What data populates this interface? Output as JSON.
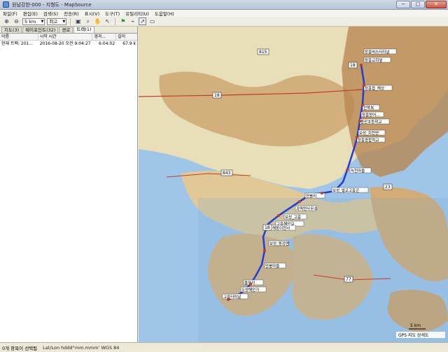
{
  "window": {
    "title": "원남강한-000 - 지형도 - MapSource",
    "buttons": {
      "minimize": "─",
      "maximize": "□",
      "close": "✕"
    }
  },
  "menu": [
    "파일(F)",
    "편집(E)",
    "검색(S)",
    "전송(R)",
    "표시(V)",
    "도구(T)",
    "유틸리티(U)",
    "도움말(H)"
  ],
  "toolbar": {
    "zoom_scale": "5 km",
    "detail_level": "최고"
  },
  "left_panel": {
    "tabs": [
      "지도(3)",
      "웨이포인트(32)",
      "경로",
      "트랙(1)"
    ],
    "active_tab": 3,
    "columns": [
      "이름",
      "시작 시간",
      "경과...",
      "길이"
    ],
    "rows": [
      {
        "name": "현재 트랙: 201...",
        "start": "2016-08-20 오전 9:04:27",
        "elapsed": "6:04:02",
        "length": "67.9 k"
      }
    ]
  },
  "map": {
    "road_labels": [
      "815",
      "18",
      "18",
      "18",
      "843",
      "23",
      "77"
    ],
    "place_labels": [
      "장흥버스터미널",
      "장흥교회옆",
      "장흥읍_해상",
      "천묵복",
      "장흥방어...",
      "용산초등학교",
      "보성_회천면",
      "장흥종합학교",
      "녹천마을",
      "보성_벌교고흥군",
      "연봉리",
      "과역면사무소",
      "보성_고흥",
      "고흥해안길",
      "해동이천사",
      "보성_동강면",
      "만봉마을",
      "율포리",
      "도양해안가",
      "고흥터미널"
    ],
    "scale_label": "5 km",
    "copyright": "GPS 지도 상세도"
  },
  "status": {
    "selection": "0개 항목이 선택됨",
    "coord_format": "Lat/Lon hddd°mm.mmm' WGS 84"
  },
  "colors": {
    "water": "#9fc6e8",
    "land": "#eee7c6",
    "terrain": "#c9a06a",
    "track": "#2a3fd1",
    "road": "#c43a2a"
  }
}
